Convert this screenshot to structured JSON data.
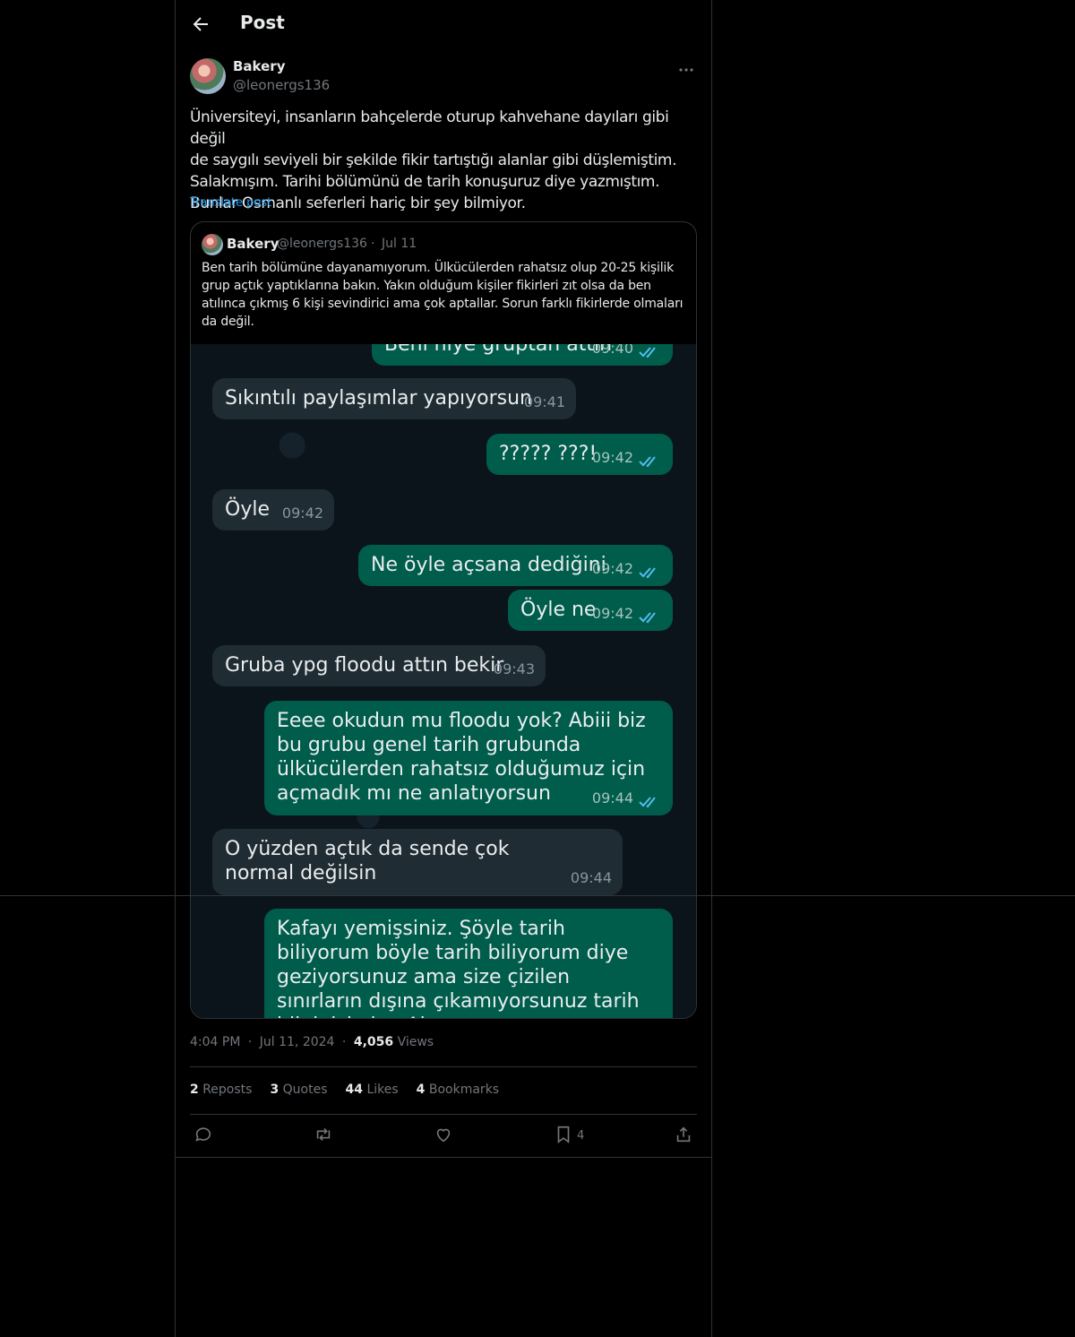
{
  "header": {
    "title": "Post"
  },
  "author": {
    "name": "Bakery",
    "handle": "@leonergs136"
  },
  "post": {
    "text": "Üniversiteyi, insanların bahçelerde oturup kahvehane dayıları gibi değil\nde saygılı seviyeli bir şekilde fikir tartıştığı alanlar gibi düşlemiştim.\nSalakmışım. Tarihi bölümünü de tarih konuşuruz diye yazmıştım.\nBunlar Osmanlı seferleri hariç bir şey bilmiyor.",
    "translate_label": "Translate post"
  },
  "quote": {
    "name": "Bakery",
    "handle": "@leonergs136",
    "separator": "·",
    "date": "Jul 11",
    "text": "Ben tarih bölümüne dayanamıyorum. Ülkücülerden rahatsız olup 20-25 kişilik grup açtık yaptıklarına bakın. Yakın olduğum kişiler fikirleri zıt olsa da ben atılınca çıkmış 6 kişi sevindirici ama çok aptallar. Sorun farklı fikirlerde olmaları da değil."
  },
  "chat": {
    "messages": [
      {
        "text": "Beni niye gruptan attın",
        "time": "09:40",
        "direction": "out"
      },
      {
        "text": "Sıkıntılı paylaşımlar yapıyorsun",
        "time": "09:41",
        "direction": "in"
      },
      {
        "text": "????? ???!",
        "time": "09:42",
        "direction": "out"
      },
      {
        "text": "Öyle",
        "time": "09:42",
        "direction": "in"
      },
      {
        "text": "Ne öyle açsana dediğini",
        "time": "09:42",
        "direction": "out"
      },
      {
        "text": "Öyle ne",
        "time": "09:42",
        "direction": "out"
      },
      {
        "text": "Gruba ypg floodu attın bekir",
        "time": "09:43",
        "direction": "in"
      },
      {
        "text": "Eeee okudun mu floodu yok? Abiii biz bu grubu genel tarih grubunda ülkücülerden rahatsız olduğumuz için açmadık mı ne anlatıyorsun",
        "time": "09:44",
        "direction": "out"
      },
      {
        "text": "O yüzden açtık da sende çok normal değilsin",
        "time": "09:44",
        "direction": "in"
      },
      {
        "text": "Kafayı yemişsiniz. Şöyle tarih biliyorum böyle tarih biliyorum diye geziyorsunuz ama size çizilen sınırların dışına çıkamıyorsunuz tarih bilginizi alın. Alın",
        "time": "",
        "direction": "out"
      }
    ]
  },
  "meta": {
    "time": "4:04 PM",
    "separator": "·",
    "date": "Jul 11, 2024",
    "views_count": "4,056",
    "views_label": "Views"
  },
  "stats": {
    "reposts_count": "2",
    "reposts_label": "Reposts",
    "quotes_count": "3",
    "quotes_label": "Quotes",
    "likes_count": "44",
    "likes_label": "Likes",
    "bookmarks_count": "4",
    "bookmarks_label": "Bookmarks"
  },
  "actions": {
    "bookmark_count": "4"
  },
  "colors": {
    "accent": "#1d9bf0",
    "background": "#000000",
    "border": "#2f3336",
    "muted": "#71767b",
    "chat_out": "#005c4b",
    "chat_in": "#202c33",
    "tick_blue": "#53bdeb"
  }
}
